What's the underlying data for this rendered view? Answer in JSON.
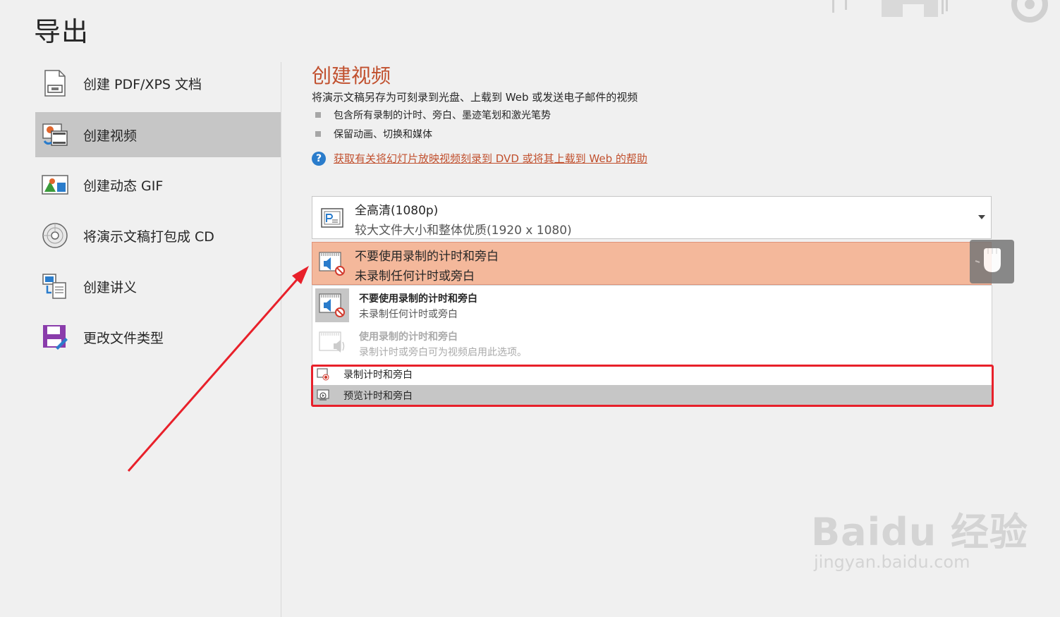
{
  "page": {
    "title": "导出"
  },
  "nav": {
    "items": [
      {
        "label": "创建 PDF/XPS 文档",
        "icon": "pdf-document-icon"
      },
      {
        "label": "创建视频",
        "icon": "video-icon",
        "active": true
      },
      {
        "label": "创建动态 GIF",
        "icon": "gif-image-icon"
      },
      {
        "label": "将演示文稿打包成 CD",
        "icon": "cd-disc-icon"
      },
      {
        "label": "创建讲义",
        "icon": "handout-icon"
      },
      {
        "label": "更改文件类型",
        "icon": "change-file-type-icon"
      }
    ]
  },
  "main": {
    "title": "创建视频",
    "description": "将演示文稿另存为可刻录到光盘、上载到 Web 或发送电子邮件的视频",
    "bullets": [
      "包含所有录制的计时、旁白、墨迹笔划和激光笔势",
      "保留动画、切换和媒体"
    ],
    "help_link": "获取有关将幻灯片放映视频刻录到 DVD 或将其上载到 Web 的帮助"
  },
  "quality_dropdown": {
    "line1": "全高清(1080p)",
    "line2": "较大文件大小和整体优质(1920 x 1080)"
  },
  "timing_dropdown": {
    "line1": "不要使用录制的计时和旁白",
    "line2": "未录制任何计时或旁白"
  },
  "timing_menu": {
    "options": [
      {
        "title": "不要使用录制的计时和旁白",
        "subtitle": "未录制任何计时或旁白",
        "selected": true,
        "enabled": true
      },
      {
        "title": "使用录制的计时和旁白",
        "subtitle": "录制计时或旁白可为视频启用此选项。",
        "selected": false,
        "enabled": false
      }
    ],
    "commands": [
      "录制计时和旁白",
      "预览计时和旁白"
    ]
  },
  "colors": {
    "accent": "#c1502e",
    "selected_dropdown": "#f4b89b",
    "annotation": "#e8202a",
    "active_nav": "#c6c6c6",
    "help_icon": "#2a7ccb"
  },
  "watermark": {
    "line1": "Baidu 经验",
    "line2": "jingyan.baidu.com"
  }
}
